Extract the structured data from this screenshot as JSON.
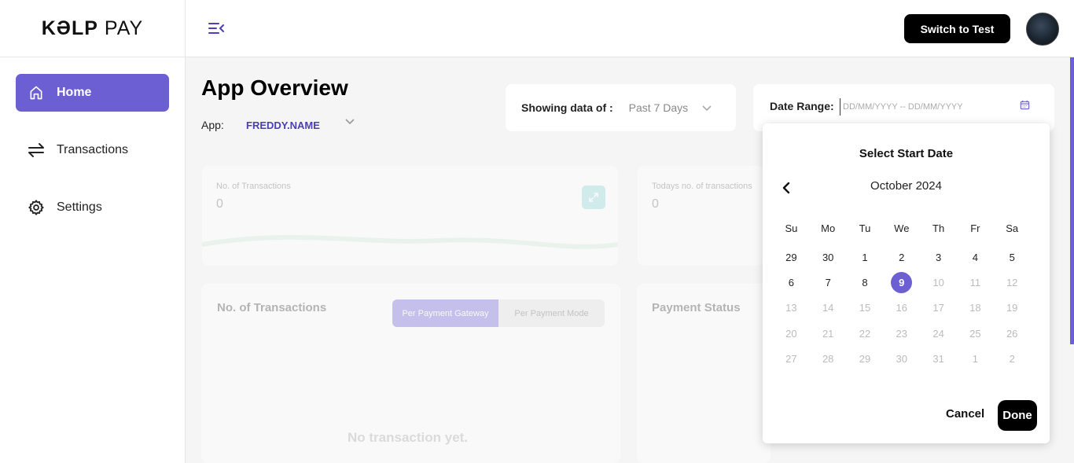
{
  "brand": {
    "logo_main": "KƏLP",
    "logo_suffix": "PAY"
  },
  "sidebar": {
    "items": [
      {
        "label": "Home",
        "icon": "home-icon",
        "active": true
      },
      {
        "label": "Transactions",
        "icon": "swap-arrows-icon",
        "active": false
      },
      {
        "label": "Settings",
        "icon": "gear-icon",
        "active": false
      }
    ]
  },
  "header": {
    "switch_label": "Switch to Test",
    "menu_icon": "menu-collapse-icon",
    "avatar_icon": "user-avatar"
  },
  "main": {
    "title": "App Overview",
    "app_label": "App:",
    "app_value": "FREDDY.NAME",
    "showing_label": "Showing data of :",
    "showing_value": "Past 7 Days",
    "range_label": "Date Range:",
    "range_placeholder": "DD/MM/YYYY -- DD/MM/YYYY",
    "stats": [
      {
        "label": "No. of Transactions",
        "value": "0"
      },
      {
        "label": "Todays no. of transactions",
        "value": "0"
      }
    ],
    "charts": [
      {
        "title": "No. of Transactions",
        "tabs": [
          "Per Payment Gateway",
          "Per Payment Mode"
        ],
        "active_tab": "Per Payment Gateway",
        "empty": "No transaction yet."
      },
      {
        "title": "Payment Status"
      }
    ]
  },
  "datepicker": {
    "title": "Select Start Date",
    "month": "October 2024",
    "weekdays": [
      "Su",
      "Mo",
      "Tu",
      "We",
      "Th",
      "Fr",
      "Sa"
    ],
    "weeks": [
      [
        "29",
        "30",
        "1",
        "2",
        "3",
        "4",
        "5"
      ],
      [
        "6",
        "7",
        "8",
        "9",
        "10",
        "11",
        "12"
      ],
      [
        "13",
        "14",
        "15",
        "16",
        "17",
        "18",
        "19"
      ],
      [
        "20",
        "21",
        "22",
        "23",
        "24",
        "25",
        "26"
      ],
      [
        "27",
        "28",
        "29",
        "30",
        "31",
        "1",
        "2"
      ]
    ],
    "selected": "9",
    "cancel_label": "Cancel",
    "done_label": "Done",
    "accent": "#6b5fd3"
  }
}
